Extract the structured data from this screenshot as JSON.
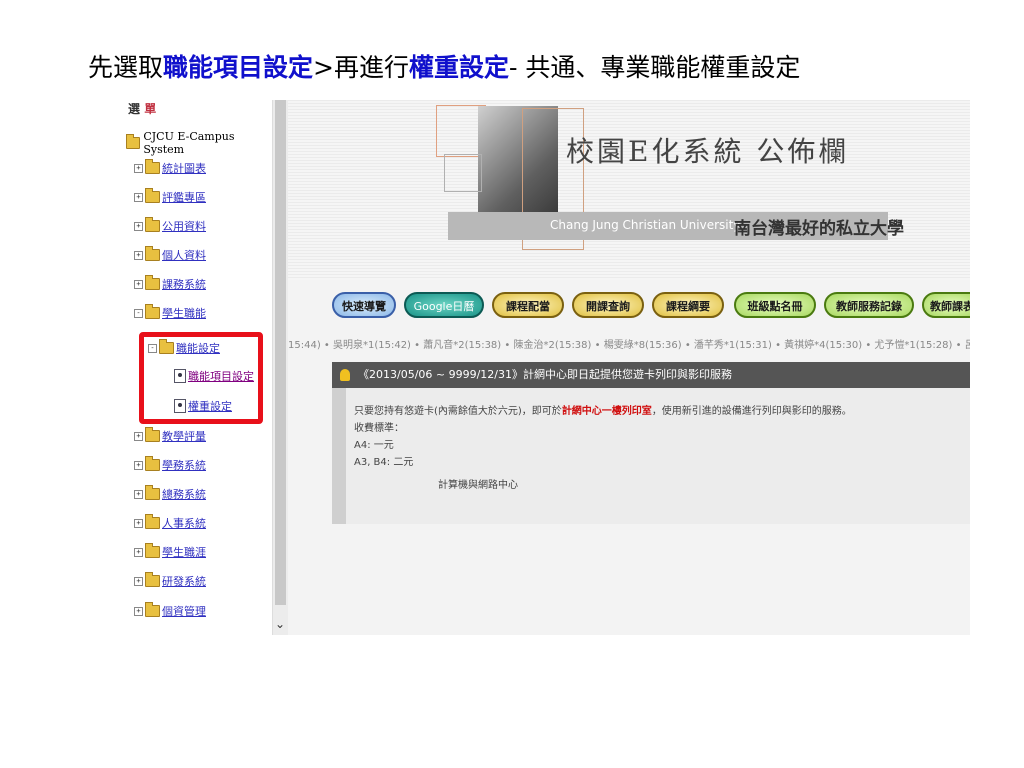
{
  "slide_title": {
    "prefix": "先選取",
    "step1": "職能項目設定",
    "arrow": ">再進行",
    "step2": "權重設定",
    "suffix": "- 共通、專業職能權重設定"
  },
  "tree": {
    "top_label_1": "選",
    "top_label_2": "單",
    "root": "CJCU E-Campus System",
    "items": [
      {
        "label": "統計圖表",
        "toggle": "+"
      },
      {
        "label": "評鑑專區",
        "toggle": "+"
      },
      {
        "label": "公用資料",
        "toggle": "+"
      },
      {
        "label": "個人資料",
        "toggle": "+"
      },
      {
        "label": "課務系統",
        "toggle": "+"
      },
      {
        "label": "學生職能",
        "toggle": "-"
      },
      {
        "label": "職能設定",
        "toggle": "-"
      },
      {
        "label": "職能項目設定"
      },
      {
        "label": "權重設定"
      },
      {
        "label": "教學評量",
        "toggle": "+"
      },
      {
        "label": "學務系統",
        "toggle": "+"
      },
      {
        "label": "總務系統",
        "toggle": "+"
      },
      {
        "label": "人事系統",
        "toggle": "+"
      },
      {
        "label": "學生職涯",
        "toggle": "+"
      },
      {
        "label": "研發系統",
        "toggle": "+"
      },
      {
        "label": "個資管理",
        "toggle": "+"
      }
    ]
  },
  "banner": {
    "title": "校園E化系統 公佈欄",
    "university_en": "Chang Jung Christian University",
    "slogan": "南台灣最好的私立大學"
  },
  "nav": [
    {
      "label": "快速導覽",
      "style": "blue"
    },
    {
      "label": "Google日曆",
      "style": "teal"
    },
    {
      "label": "課程配當",
      "style": "gold"
    },
    {
      "label": "開課查詢",
      "style": "gold"
    },
    {
      "label": "課程綱要",
      "style": "gold"
    },
    {
      "label": "班級點名冊",
      "style": "green"
    },
    {
      "label": "教師服務記錄",
      "style": "green"
    },
    {
      "label": "教師課表",
      "style": "green"
    }
  ],
  "marquee": "15:44) • 吳明泉*1(15:42) • 蕭凡音*2(15:38) • 陳金治*2(15:38) • 楊雯綠*8(15:36) • 潘芊秀*1(15:31) • 黃祺婷*4(15:30) • 尤予愷*1(15:28) • 呂",
  "announcement": {
    "title": "《2013/05/06 ~ 9999/12/31》計網中心即日起提供您遊卡列印與影印服務",
    "line1_a": "只要您持有悠遊卡(內需餘值大於六元)，即可於",
    "line1_red": "計網中心一樓列印室",
    "line1_b": "，使用新引進的設備進行列印與影印的服務。",
    "line2": "收費標準：",
    "line3": "A4: 一元",
    "line4": "A3, B4: 二元",
    "signature": "計算機與網路中心"
  },
  "icons": {
    "scroll_down": "chevron-down-icon"
  }
}
